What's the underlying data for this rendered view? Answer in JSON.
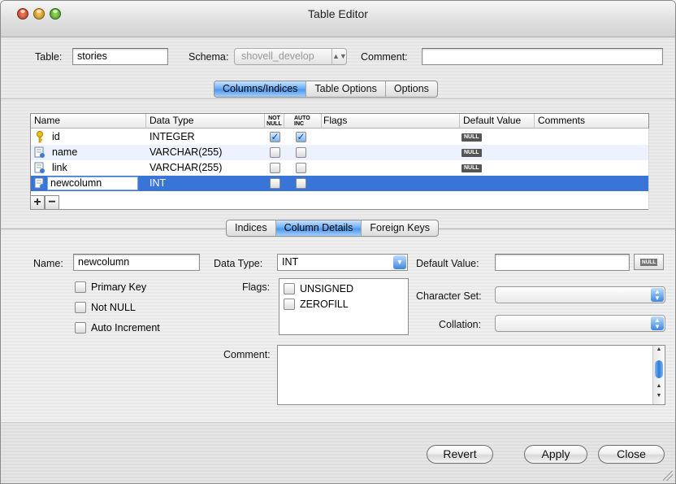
{
  "window": {
    "title": "Table Editor"
  },
  "header": {
    "table_label": "Table:",
    "table_value": "stories",
    "schema_label": "Schema:",
    "schema_value": "shovell_develop",
    "comment_label": "Comment:",
    "comment_value": ""
  },
  "top_tabs": [
    {
      "label": "Columns/Indices",
      "selected": true
    },
    {
      "label": "Table Options",
      "selected": false
    },
    {
      "label": "Options",
      "selected": false
    }
  ],
  "columns_table": {
    "headers": {
      "name": "Name",
      "data_type": "Data Type",
      "not_null_1": "NOT",
      "not_null_2": "NULL",
      "auto_inc_1": "AUTO",
      "auto_inc_2": "INC",
      "flags": "Flags",
      "default_value": "Default Value",
      "comments": "Comments"
    },
    "rows": [
      {
        "name": "id",
        "type": "INTEGER",
        "not_null": true,
        "auto_inc": true,
        "default": "NULL",
        "icon": "key-icon"
      },
      {
        "name": "name",
        "type": "VARCHAR(255)",
        "not_null": false,
        "auto_inc": false,
        "default": "NULL",
        "icon": "column-icon"
      },
      {
        "name": "link",
        "type": "VARCHAR(255)",
        "not_null": false,
        "auto_inc": false,
        "default": "NULL",
        "icon": "column-icon"
      },
      {
        "name": "newcolumn",
        "type": "INT",
        "not_null": false,
        "auto_inc": false,
        "default": "",
        "icon": "column-icon",
        "selected": true
      }
    ],
    "add_symbol": "+",
    "remove_symbol": "−"
  },
  "bottom_tabs": [
    {
      "label": "Indices",
      "selected": false
    },
    {
      "label": "Column Details",
      "selected": true
    },
    {
      "label": "Foreign Keys",
      "selected": false
    }
  ],
  "details": {
    "name_label": "Name:",
    "name_value": "newcolumn",
    "datatype_label": "Data Type:",
    "datatype_value": "INT",
    "default_label": "Default Value:",
    "default_value": "",
    "null_button": "NULL",
    "primary_key_label": "Primary Key",
    "not_null_label": "Not NULL",
    "auto_increment_label": "Auto Increment",
    "flags_label": "Flags:",
    "flags": [
      "UNSIGNED",
      "ZEROFILL"
    ],
    "charset_label": "Character Set:",
    "charset_value": "",
    "collation_label": "Collation:",
    "collation_value": "",
    "comment_label": "Comment:",
    "comment_value": ""
  },
  "footer": {
    "revert_label": "Revert",
    "apply_label": "Apply",
    "close_label": "Close"
  },
  "colors": {
    "selection_blue": "#3875d7",
    "tab_selected": "#6fb0f4",
    "alt_row": "#edf3fe"
  }
}
